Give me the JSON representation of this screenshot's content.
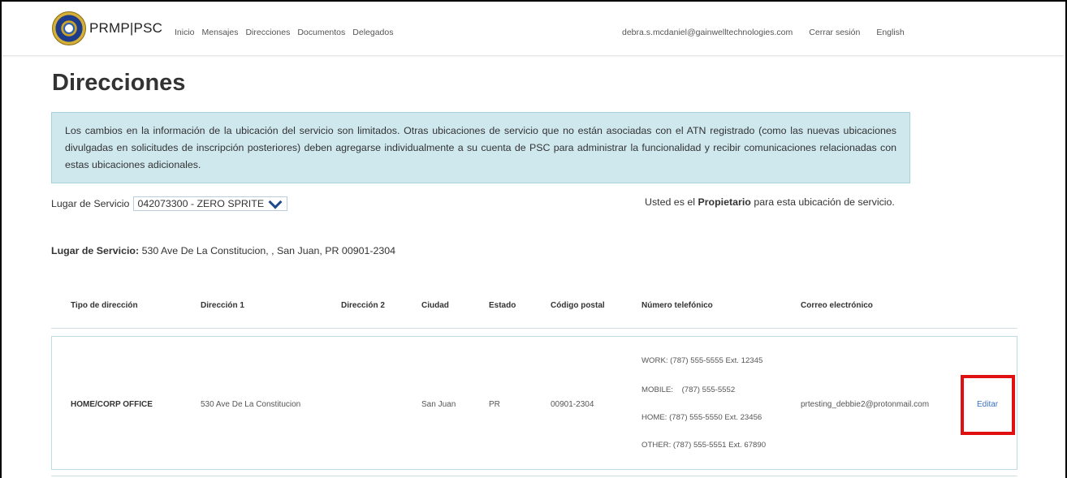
{
  "header": {
    "brand": "PRMP|PSC",
    "nav": [
      "Inicio",
      "Mensajes",
      "Direcciones",
      "Documentos",
      "Delegados"
    ],
    "user_email": "debra.s.mcdaniel@gainwelltechnologies.com",
    "logout": "Cerrar sesión",
    "language": "English"
  },
  "page": {
    "title": "Direcciones",
    "alert": "Los cambios en la información de la ubicación del servicio son limitados. Otras ubicaciones de servicio que no están asociadas con el ATN registrado (como las nuevas ubicaciones divulgadas en solicitudes de inscripción posteriores) deben agregarse individualmente a su cuenta de PSC para administrar la funcionalidad y recibir comunicaciones relacionadas con estas ubicaciones adicionales.",
    "lugar_label": "Lugar de Servicio",
    "lugar_value": "042073300 - ZERO SPRITE",
    "owner_prefix": "Usted es el",
    "owner_role": "Propietario",
    "owner_suffix": "para esta ubicación de servicio.",
    "service_label": "Lugar de Servicio:",
    "service_address": "530 Ave De La Constitucion, , San Juan, PR 00901-2304"
  },
  "table": {
    "headers": {
      "tipo": "Tipo de dirección",
      "dir1": "Dirección 1",
      "dir2": "Dirección 2",
      "ciudad": "Ciudad",
      "estado": "Estado",
      "cp": "Código postal",
      "tel": "Número telefónico",
      "correo": "Correo electrónico"
    },
    "row": {
      "tipo": "HOME/CORP OFFICE",
      "dir1": "530 Ave De La Constitucion",
      "dir2": "",
      "ciudad": "San Juan",
      "estado": "PR",
      "cp": "00901-2304",
      "phones": [
        "WORK: (787) 555-5555 Ext. 12345",
        "MOBILE:    (787) 555-5552",
        "HOME: (787) 555-5550 Ext. 23456",
        "OTHER: (787) 555-5551 Ext. 67890"
      ],
      "correo": "prtesting_debbie2@protonmail.com",
      "action": "Editar"
    }
  },
  "colors": {
    "alert_bg": "#cfe8ee",
    "link": "#3a6fc4",
    "highlight": "#e01010"
  }
}
